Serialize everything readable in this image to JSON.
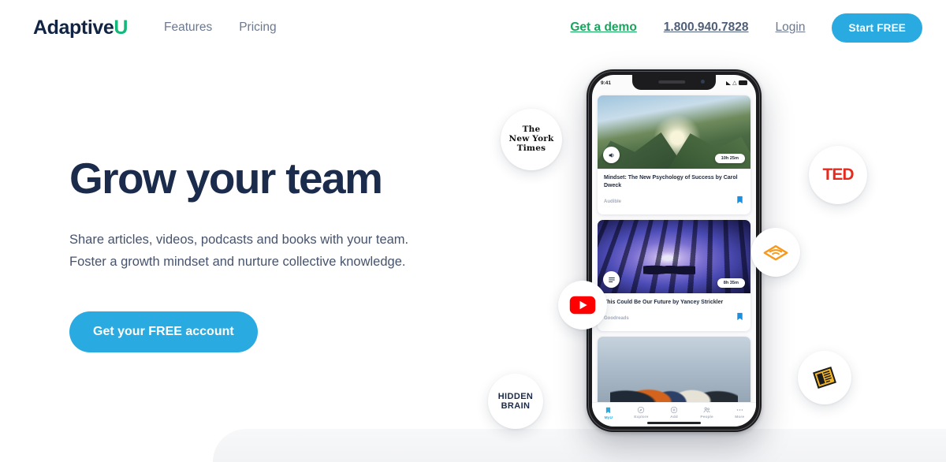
{
  "header": {
    "logo_main": "Adaptive",
    "logo_accent": "U",
    "nav": [
      {
        "label": "Features"
      },
      {
        "label": "Pricing"
      }
    ],
    "demo_label": "Get a demo",
    "phone": "1.800.940.7828",
    "login_label": "Login",
    "start_label": "Start FREE"
  },
  "hero": {
    "headline": "Grow your team",
    "subhead_line1": "Share articles, videos, podcasts and books with your team.",
    "subhead_line2": "Foster a growth mindset and nurture collective knowledge.",
    "cta_label": "Get your FREE account"
  },
  "phone": {
    "status_time": "9:41",
    "cards": [
      {
        "title": "Mindset: The New Psychology of Success by Carol Dweck",
        "source": "Audible",
        "duration": "10h 25m",
        "media_icon": "speaker-icon",
        "bookmarked": true
      },
      {
        "title": "This Could Be Our Future by Yancey Strickler",
        "source": "Goodreads",
        "duration": "8h 35m",
        "media_icon": "article-icon",
        "bookmarked": true
      },
      {
        "title": "",
        "source": "",
        "duration": "",
        "media_icon": "",
        "bookmarked": false
      }
    ],
    "tabs": [
      {
        "label": "MyU",
        "icon": "bookmark-icon",
        "active": true
      },
      {
        "label": "Explore",
        "icon": "compass-icon",
        "active": false
      },
      {
        "label": "Add",
        "icon": "plus-circle-icon",
        "active": false
      },
      {
        "label": "People",
        "icon": "people-icon",
        "active": false
      },
      {
        "label": "More",
        "icon": "ellipsis-icon",
        "active": false
      }
    ]
  },
  "bubbles": {
    "nyt_l1": "The",
    "nyt_l2": "New York",
    "nyt_l3": "Times",
    "ted": "TED",
    "audible": "audible-logo",
    "youtube": "youtube-logo",
    "hidden_l1": "HIDDEN",
    "hidden_l2": "BRAIN",
    "economist": "newspaper-logo"
  },
  "colors": {
    "accent_blue": "#29abe2",
    "brand_green": "#15b87b",
    "navy": "#1b2b4b",
    "ted_red": "#e62b1e",
    "audible_orange": "#f8991c"
  }
}
